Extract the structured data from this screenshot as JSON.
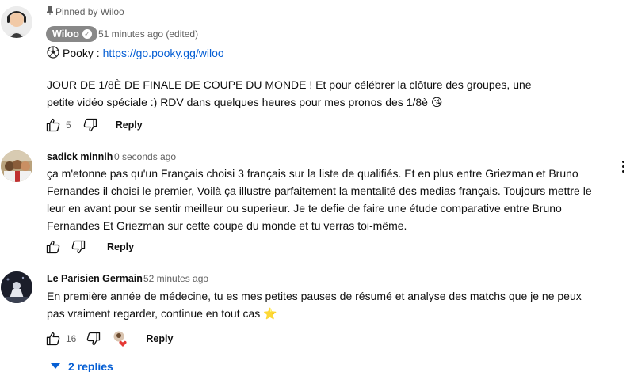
{
  "comments": [
    {
      "pinned_label": "Pinned by Wiloo",
      "author": "Wiloo",
      "timestamp": "51 minutes ago (edited)",
      "link_prefix": "Pooky : ",
      "link_text": "https://go.pooky.gg/wiloo",
      "text": "JOUR DE 1/8È DE FINALE DE COUPE DU MONDE ! Et pour célébrer la clôture des groupes, une petite vidéo spéciale :) RDV dans quelques heures pour mes pronos des 1/8è 😘",
      "likes": "5",
      "reply_label": "Reply"
    },
    {
      "author": "sadick minnih",
      "timestamp": "0 seconds ago",
      "text": "ça m'etonne pas qu'un Français choisi 3 français sur la liste de qualifiés. Et en plus entre Griezman et Bruno Fernandes il choisi le premier, Voilà ça illustre parfaitement la mentalité des medias français. Toujours mettre le leur en avant pour se sentir meilleur ou superieur. Je te defie de faire une étude comparative entre Bruno Fernandes Et Griezman sur cette coupe du monde et tu verras toi-même.",
      "reply_label": "Reply"
    },
    {
      "author": "Le Parisien Germain",
      "timestamp": "52 minutes ago",
      "text": "En première année de médecine, tu es mes petites pauses de résumé et analyse des matchs que je ne peux pas vraiment regarder, continue en tout cas ⭐",
      "likes": "16",
      "reply_label": "Reply",
      "replies_label": "2 replies"
    }
  ],
  "colors": {
    "link": "#065fd4",
    "meta": "#606060",
    "badge": "#888888",
    "heart": "#e53935"
  },
  "icons": [
    "pin-icon",
    "verified-check-icon",
    "soccer-ball-icon",
    "like-icon",
    "dislike-icon",
    "more-vert-icon",
    "creator-heart-icon",
    "chevron-down-icon"
  ]
}
